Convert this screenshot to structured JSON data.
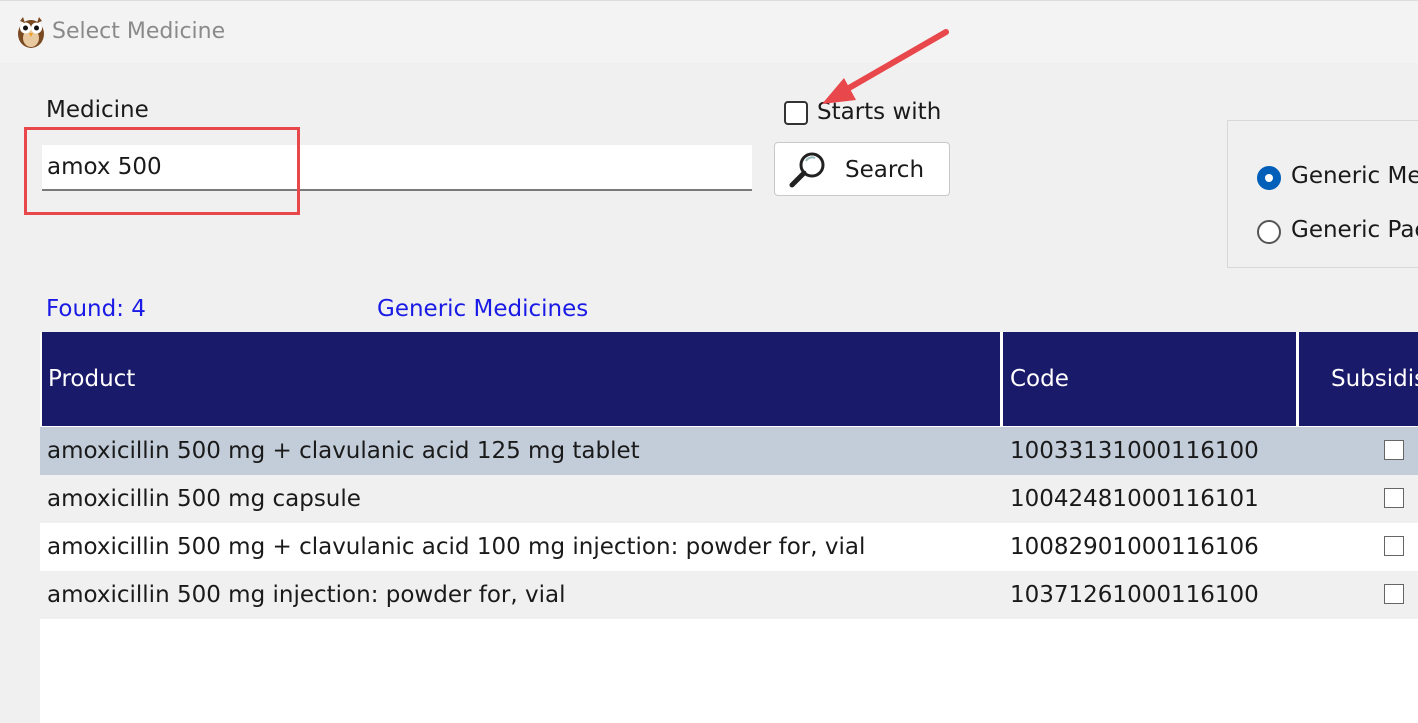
{
  "window": {
    "title": "Select Medicine",
    "app_icon": "owl-icon"
  },
  "search": {
    "medicine_label": "Medicine",
    "medicine_value": "amox 500",
    "starts_with_label": "Starts with",
    "starts_with_checked": false,
    "search_button_label": "Search"
  },
  "options": {
    "generic_medicines_label": "Generic Me",
    "generic_packs_label": "Generic Pac",
    "selected": "generic_medicines"
  },
  "results": {
    "found_text": "Found: 4",
    "category_text": "Generic Medicines",
    "columns": [
      "Product",
      "Code",
      "Subsidis"
    ],
    "rows": [
      {
        "product": "amoxicillin 500 mg + clavulanic acid 125 mg tablet",
        "code": "10033131000116100",
        "subsidised": false
      },
      {
        "product": "amoxicillin 500 mg capsule",
        "code": "10042481000116101",
        "subsidised": false
      },
      {
        "product": "amoxicillin 500 mg + clavulanic acid 100 mg injection: powder for, vial",
        "code": "10082901000116106",
        "subsidised": false
      },
      {
        "product": "amoxicillin 500 mg injection: powder for, vial",
        "code": "10371261000116100",
        "subsidised": false
      }
    ]
  },
  "colors": {
    "header_bg": "#1a1a6b",
    "selected_row": "#c2cdd9",
    "link_blue": "#1a1ae6",
    "annotation_red": "#e8474c",
    "radio_blue": "#005fb8"
  }
}
